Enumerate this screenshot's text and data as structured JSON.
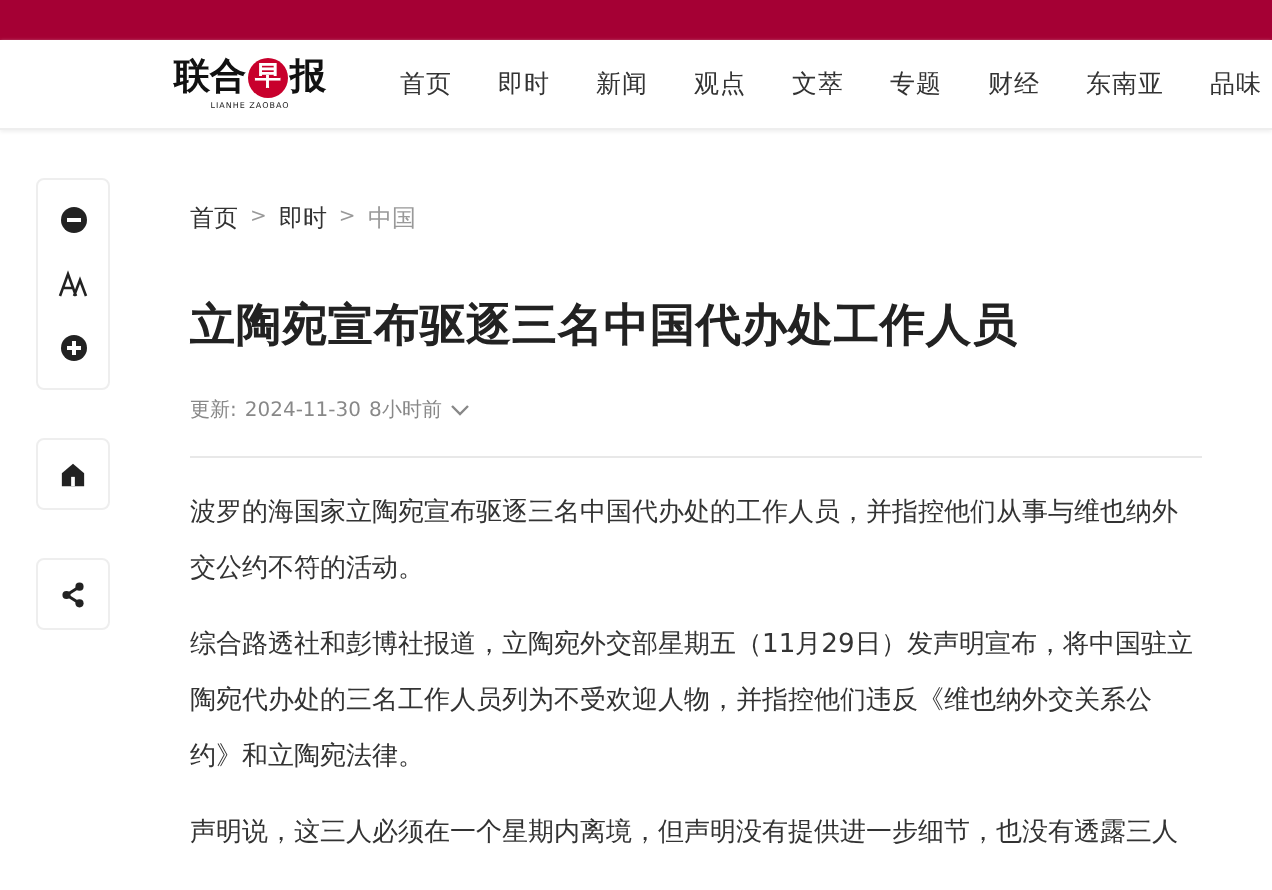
{
  "logo": {
    "text_before": "联合",
    "badge": "早",
    "text_after": "报",
    "subtitle": "LIANHE ZAOBAO"
  },
  "nav": [
    {
      "label": "首页"
    },
    {
      "label": "即时"
    },
    {
      "label": "新闻"
    },
    {
      "label": "观点"
    },
    {
      "label": "文萃"
    },
    {
      "label": "专题"
    },
    {
      "label": "财经"
    },
    {
      "label": "东南亚"
    },
    {
      "label": "品味"
    }
  ],
  "breadcrumb": [
    {
      "label": "首页",
      "current": false
    },
    {
      "label": "即时",
      "current": false
    },
    {
      "label": "中国",
      "current": true
    }
  ],
  "breadcrumb_separator": ">",
  "title": "立陶宛宣布驱逐三名中国代办处工作人员",
  "meta": {
    "label": "更新:",
    "date": "2024-11-30",
    "ago": "8小时前"
  },
  "paragraphs": [
    "波罗的海国家立陶宛宣布驱逐三名中国代办处的工作人员，并指控他们从事与维也纳外交公约不符的活动。",
    "综合路透社和彭博社报道，立陶宛外交部星期五（11月29日）发声明宣布，将中国驻立陶宛代办处的三名工作人员列为不受欢迎人物，并指控他们违反《维也纳外交关系公约》和立陶宛法律。",
    "声明说，这三人必须在一个星期内离境，但声明没有提供进一步细节，也没有透露三人"
  ]
}
